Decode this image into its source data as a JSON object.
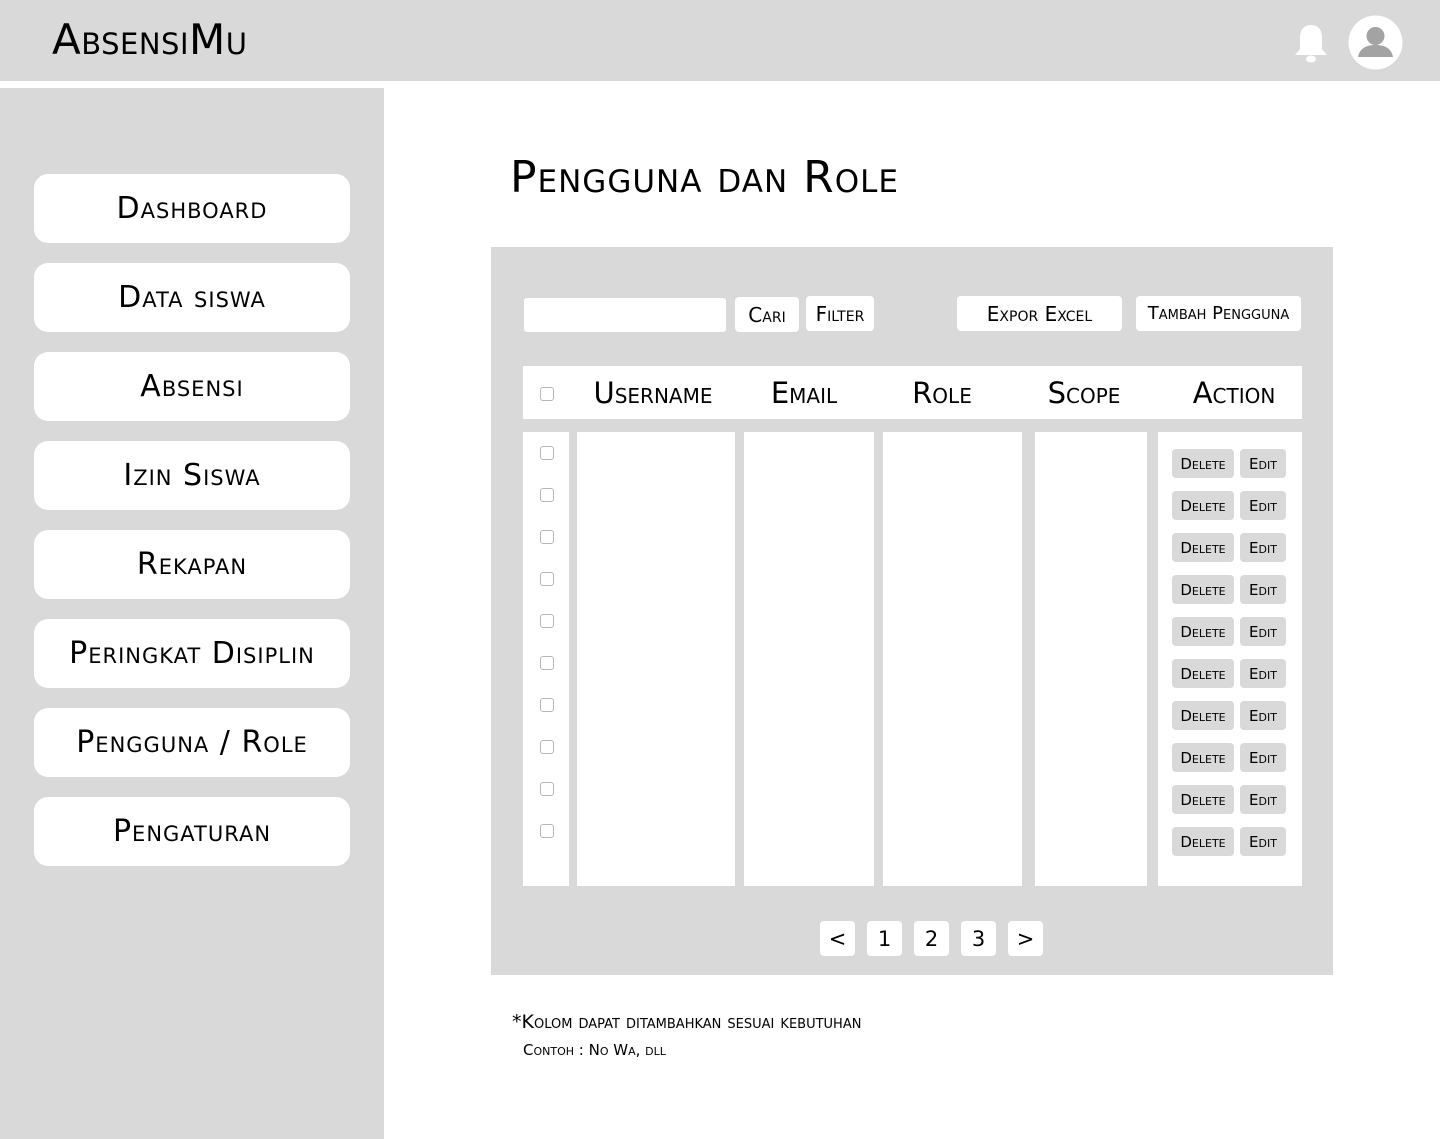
{
  "app": {
    "title": "AbsensiMu"
  },
  "header": {
    "icons": [
      "bell-icon",
      "user-avatar-icon"
    ]
  },
  "sidebar": {
    "items": [
      {
        "label": "Dashboard"
      },
      {
        "label": "Data siswa"
      },
      {
        "label": "Absensi"
      },
      {
        "label": "Izin Siswa"
      },
      {
        "label": "Rekapan"
      },
      {
        "label": "Peringkat Disiplin"
      },
      {
        "label": "Pengguna / Role"
      },
      {
        "label": "Pengaturan"
      }
    ]
  },
  "main": {
    "title": "Pengguna dan Role",
    "toolbar": {
      "search_value": "",
      "search_label": "Cari",
      "filter_label": "Filter",
      "export_label": "Expor Excel",
      "add_label": "Tambah Pengguna"
    },
    "table": {
      "columns": [
        "Username",
        "Email",
        "Role",
        "Scope",
        "Action"
      ],
      "row_actions": {
        "delete": "Delete",
        "edit": "Edit"
      }
    },
    "pagination": {
      "prev": "<",
      "pages": [
        "1",
        "2",
        "3"
      ],
      "next": ">"
    },
    "note": {
      "line1": "*Kolom dapat ditambahkan sesuai kebutuhan",
      "line2": "Contoh : No Wa, dll"
    }
  }
}
